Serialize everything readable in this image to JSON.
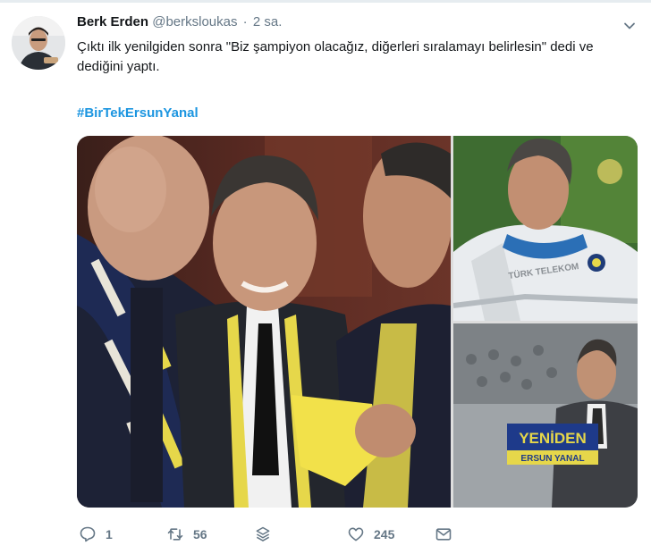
{
  "author": {
    "name": "Berk Erden",
    "handle": "@berksloukas",
    "separator": "·",
    "time": "2 sa."
  },
  "tweet": {
    "text": "Çıktı ilk yenilgiden sonra \"Biz şampiyon olacağız, diğerleri sıralamayı belirlesin\" dedi ve dediğini yaptı.",
    "hashtag": "#BirTekErsunYanal"
  },
  "media": {
    "overlay_line1": "YENİDEN",
    "overlay_line2": "ERSUN YANAL",
    "jacket_text": "TÜRK TELEKOM"
  },
  "actions": {
    "reply_count": "1",
    "retweet_count": "56",
    "like_count": "245"
  },
  "icons": {
    "caret": "chevron-down-icon",
    "reply": "reply-icon",
    "retweet": "retweet-icon",
    "stack": "stack-icon",
    "like": "heart-icon",
    "dm": "envelope-icon"
  },
  "colors": {
    "link": "#1b95e0",
    "muted": "#657786",
    "text": "#14171a"
  }
}
